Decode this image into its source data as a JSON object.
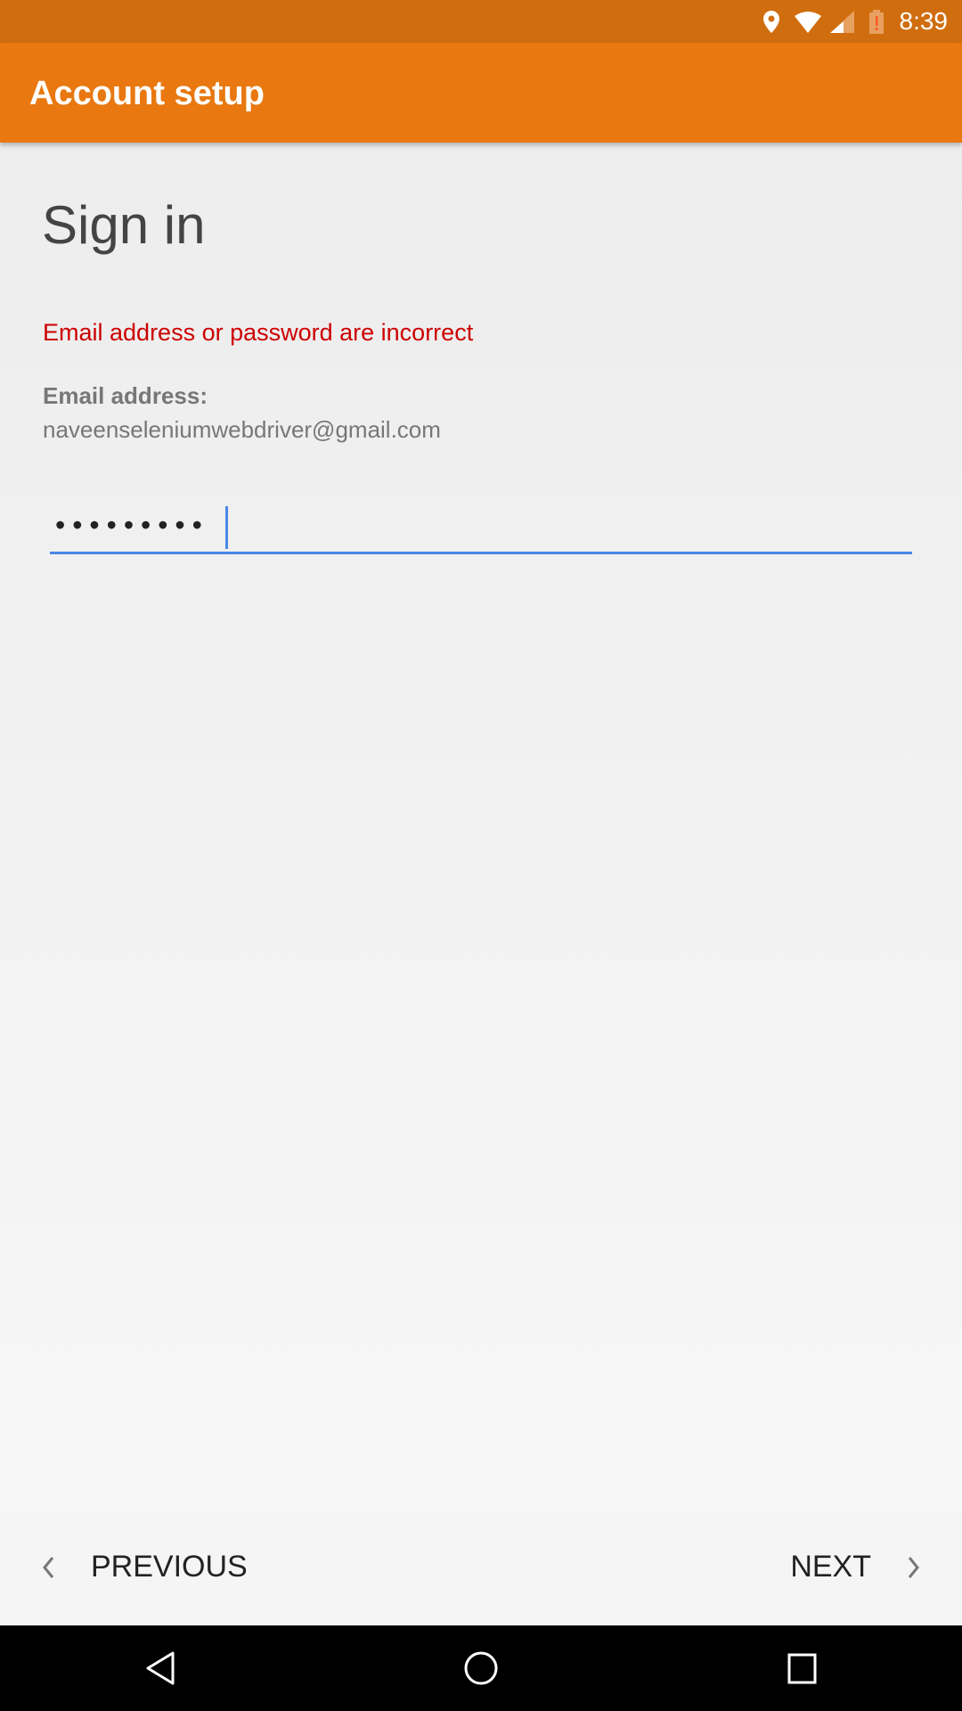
{
  "status_bar": {
    "time": "8:39",
    "icons": [
      "location-icon",
      "wifi-icon",
      "signal-icon",
      "battery-alert-icon"
    ]
  },
  "app_bar": {
    "title": "Account setup"
  },
  "main": {
    "heading": "Sign in",
    "error": "Email address or password are incorrect",
    "email_label": "Email address:",
    "email_value": "naveenseleniumwebdriver@gmail.com",
    "password_value": "•••••••••"
  },
  "footer": {
    "previous_label": "PREVIOUS",
    "next_label": "NEXT"
  },
  "colors": {
    "accent": "#e8780f",
    "status": "#d06d0e",
    "error": "#cc0000",
    "focus": "#4a86e8"
  }
}
